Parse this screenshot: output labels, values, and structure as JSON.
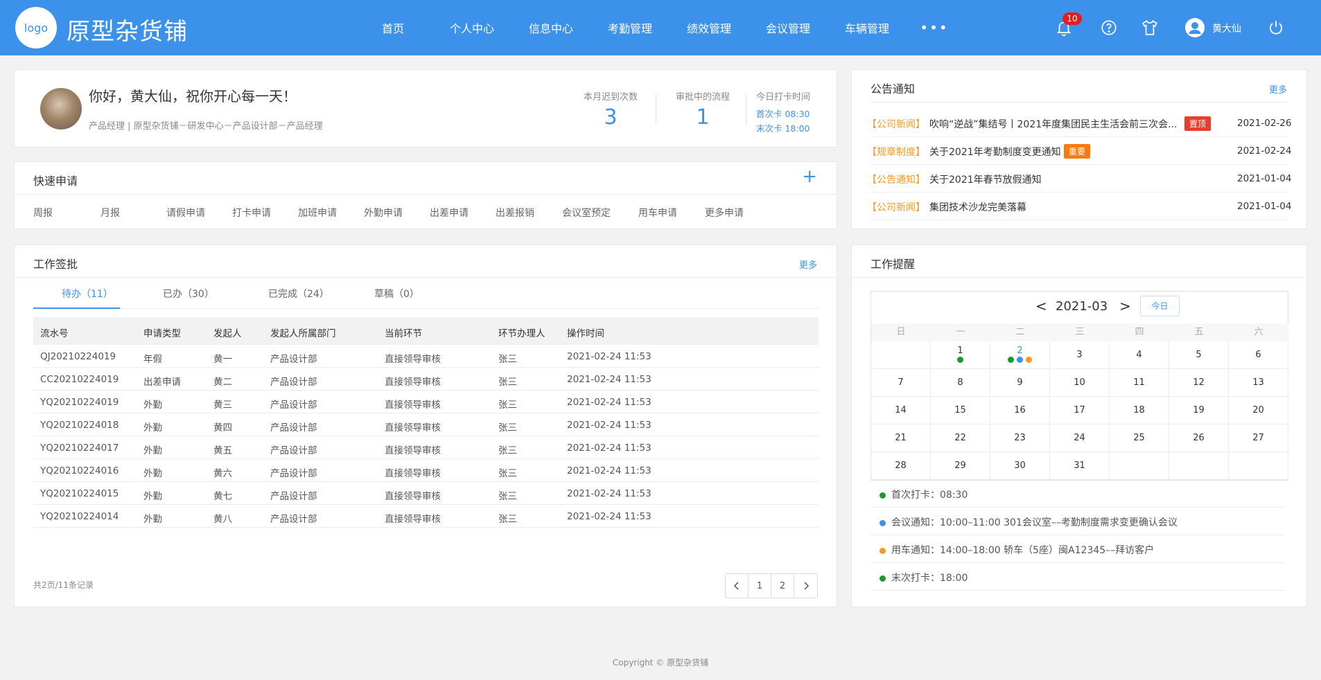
{
  "header": {
    "logo_text": "logo",
    "brand": "原型杂货铺",
    "nav": [
      "首页",
      "个人中心",
      "信息中心",
      "考勤管理",
      "绩效管理",
      "会议管理",
      "车辆管理"
    ],
    "nav_more": "•••",
    "notification_count": "10",
    "user_name": "黄大仙",
    "bg_color": "#3c91ea"
  },
  "profile": {
    "greeting": "你好，黄大仙，祝你开心每一天！",
    "subtitle": "产品经理  |  原型杂货铺－研发中心－产品设计部－产品经理",
    "late_label": "本月迟到次数",
    "late_value": "3",
    "flow_label": "审批中的流程",
    "flow_value": "1",
    "clock_label": "今日打卡时间",
    "clock_in": "首次卡  08:30",
    "clock_out": "末次卡  18:00"
  },
  "quick_apply": {
    "title": "快速申请",
    "items": [
      "周报",
      "月报",
      "请假申请",
      "打卡申请",
      "加班申请",
      "外勤申请",
      "出差申请",
      "出差报销",
      "会议室预定",
      "用车申请",
      "更多申请"
    ]
  },
  "work": {
    "title": "工作签批",
    "more": "更多",
    "tabs": [
      "待办（11）",
      "已办（30）",
      "已完成（24）",
      "草稿（0）"
    ],
    "columns": [
      "流水号",
      "申请类型",
      "发起人",
      "发起人所属部门",
      "当前环节",
      "环节办理人",
      "操作时间"
    ],
    "rows": [
      [
        "QJ20210224019",
        "年假",
        "黄一",
        "产品设计部",
        "直接领导审核",
        "张三",
        "2021-02-24 11:53"
      ],
      [
        "CC20210224019",
        "出差申请",
        "黄二",
        "产品设计部",
        "直接领导审核",
        "张三",
        "2021-02-24 11:53"
      ],
      [
        "YQ20210224019",
        "外勤",
        "黄三",
        "产品设计部",
        "直接领导审核",
        "张三",
        "2021-02-24 11:53"
      ],
      [
        "YQ20210224018",
        "外勤",
        "黄四",
        "产品设计部",
        "直接领导审核",
        "张三",
        "2021-02-24 11:53"
      ],
      [
        "YQ20210224017",
        "外勤",
        "黄五",
        "产品设计部",
        "直接领导审核",
        "张三",
        "2021-02-24 11:53"
      ],
      [
        "YQ20210224016",
        "外勤",
        "黄六",
        "产品设计部",
        "直接领导审核",
        "张三",
        "2021-02-24 11:53"
      ],
      [
        "YQ20210224015",
        "外勤",
        "黄七",
        "产品设计部",
        "直接领导审核",
        "张三",
        "2021-02-24 11:53"
      ],
      [
        "YQ20210224014",
        "外勤",
        "黄八",
        "产品设计部",
        "直接领导审核",
        "张三",
        "2021-02-24 11:53"
      ]
    ],
    "summary": "共2页/11条记录",
    "pages": [
      "1",
      "2"
    ]
  },
  "notice": {
    "title": "公告通知",
    "more": "更多",
    "items": [
      {
        "tag": "【公司新闻】",
        "title": "吹响“逆战”集结号丨2021年度集团民主生活会前三次会...",
        "badge": "置顶",
        "badge_color": "#e83d2f",
        "date": "2021-02-26"
      },
      {
        "tag": "【规章制度】",
        "title": "关于2021年考勤制度变更通知",
        "badge": "重要",
        "badge_color": "#f77b10",
        "date": "2021-02-24"
      },
      {
        "tag": "【公告通知】",
        "title": "关于2021年春节放假通知",
        "badge": "",
        "badge_color": "",
        "date": "2021-01-04"
      },
      {
        "tag": "【公司新闻】",
        "title": "集团技术沙龙完美落幕",
        "badge": "",
        "badge_color": "",
        "date": "2021-01-04"
      }
    ]
  },
  "reminder": {
    "title": "工作提醒",
    "prev": "<",
    "month": "2021-03",
    "next": ">",
    "today": "今日",
    "weekdays": [
      "日",
      "一",
      "二",
      "三",
      "四",
      "五",
      "六"
    ],
    "weeks": [
      [
        "",
        "1",
        "2",
        "3",
        "4",
        "5",
        "6"
      ],
      [
        "7",
        "8",
        "9",
        "10",
        "11",
        "12",
        "13"
      ],
      [
        "14",
        "15",
        "16",
        "17",
        "18",
        "19",
        "20"
      ],
      [
        "21",
        "22",
        "23",
        "24",
        "25",
        "26",
        "27"
      ],
      [
        "28",
        "29",
        "30",
        "31",
        "",
        "",
        ""
      ]
    ],
    "items": [
      {
        "text": "首次打卡：08:30",
        "color": "#1a9a2a"
      },
      {
        "text": "会议通知：10:00–11:00  301会议室––考勤制度需求变更确认会议",
        "color": "#3c91ea"
      },
      {
        "text": "用车通知：14:00–18:00  轿车（5座）闽A12345––拜访客户",
        "color": "#f59a23"
      },
      {
        "text": "末次打卡：18:00",
        "color": "#1a9a2a"
      }
    ]
  },
  "footer": "Copyright © 原型杂货铺"
}
